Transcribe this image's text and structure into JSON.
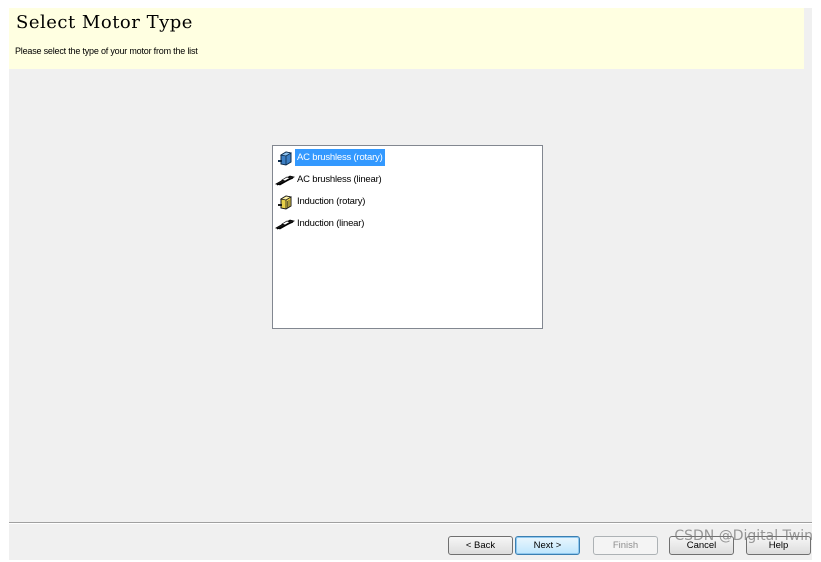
{
  "header": {
    "title": "Select Motor Type",
    "subtitle": "Please select the type of your motor from the list"
  },
  "motor_list": {
    "items": [
      {
        "label": "AC brushless (rotary)",
        "icon": "rotary-motor-blue-icon",
        "selected": true
      },
      {
        "label": "AC brushless (linear)",
        "icon": "linear-motor-icon",
        "selected": false
      },
      {
        "label": "Induction (rotary)",
        "icon": "rotary-motor-yellow-icon",
        "selected": false
      },
      {
        "label": "Induction (linear)",
        "icon": "linear-motor-icon",
        "selected": false
      }
    ],
    "selection_color": "#3399ff"
  },
  "buttons": {
    "back": "< Back",
    "next": "Next >",
    "finish": "Finish",
    "cancel": "Cancel",
    "help": "Help"
  },
  "watermark": "CSDN @Digital Twin"
}
